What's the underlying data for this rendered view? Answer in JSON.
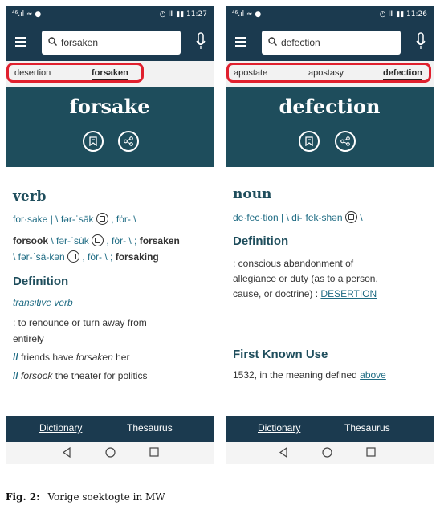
{
  "left": {
    "status_left": "⁴⁶.ıl ≈ ●",
    "status_right": "◷ ⅠⅡ ▮▮ 11:27",
    "search_value": "forsaken",
    "recent_tabs": [
      "desertion",
      "forsaken"
    ],
    "headword": "forsake",
    "part_of_speech": "verb",
    "pron_word": "for·sake",
    "pron_1": "| \\ fər-ˈsāk",
    "pron_1b": ", fȯr- \\",
    "forms_a_bold": "forsook",
    "forms_a_pron": "\\ fər-ˈsu̇k",
    "forms_a_pron_b": ", fȯr- \\ ;",
    "forms_a_bold2": "forsaken",
    "forms_b_pron": "\\ fər-ˈsā-kən",
    "forms_b_pron_b": ", fȯr- \\ ;",
    "forms_b_bold": "forsaking",
    "definition_heading": "Definition",
    "verb_type": "transitive verb",
    "def_line1": ": to renounce or turn away from",
    "def_line2": "entirely",
    "ex1_marker": "//",
    "ex1_pre": "friends have",
    "ex1_italic": "forsaken",
    "ex1_post": "her",
    "ex2_marker": "//",
    "ex2_italic": "forsook",
    "ex2_post": "the theater for politics",
    "tab_dictionary": "Dictionary",
    "tab_thesaurus": "Thesaurus"
  },
  "right": {
    "status_left": "⁴⁶.ıl ≈ ●",
    "status_right": "◷ ⅠⅡ ▮▮ 11:26",
    "search_value": "defection",
    "recent_tabs": [
      "apostate",
      "apostasy",
      "defection"
    ],
    "headword": "defection",
    "part_of_speech": "noun",
    "pron_word": "de·fec·tion",
    "pron_1": "| \\ di-ˈfek-shən",
    "pron_1b": "\\",
    "definition_heading": "Definition",
    "def_line1": ": conscious abandonment of",
    "def_line2": "allegiance or duty (as to a person,",
    "def_line3_pre": "cause, or doctrine) :",
    "def_link": "DESERTION",
    "first_use_heading": "First Known Use",
    "first_use_pre": "1532, in the meaning defined",
    "first_use_link": "above",
    "tab_dictionary": "Dictionary",
    "tab_thesaurus": "Thesaurus"
  },
  "caption": {
    "label": "Fig. 2:",
    "text": "Vorige soektogte in MW"
  },
  "colors": {
    "appbar": "#1b3a4f",
    "hero": "#1e4d5c",
    "highlight": "#e0202e"
  },
  "icons": [
    "menu-icon",
    "search-icon",
    "mic-icon",
    "bookmark-icon",
    "share-icon",
    "audio-icon",
    "back-icon",
    "home-icon",
    "recents-icon"
  ]
}
